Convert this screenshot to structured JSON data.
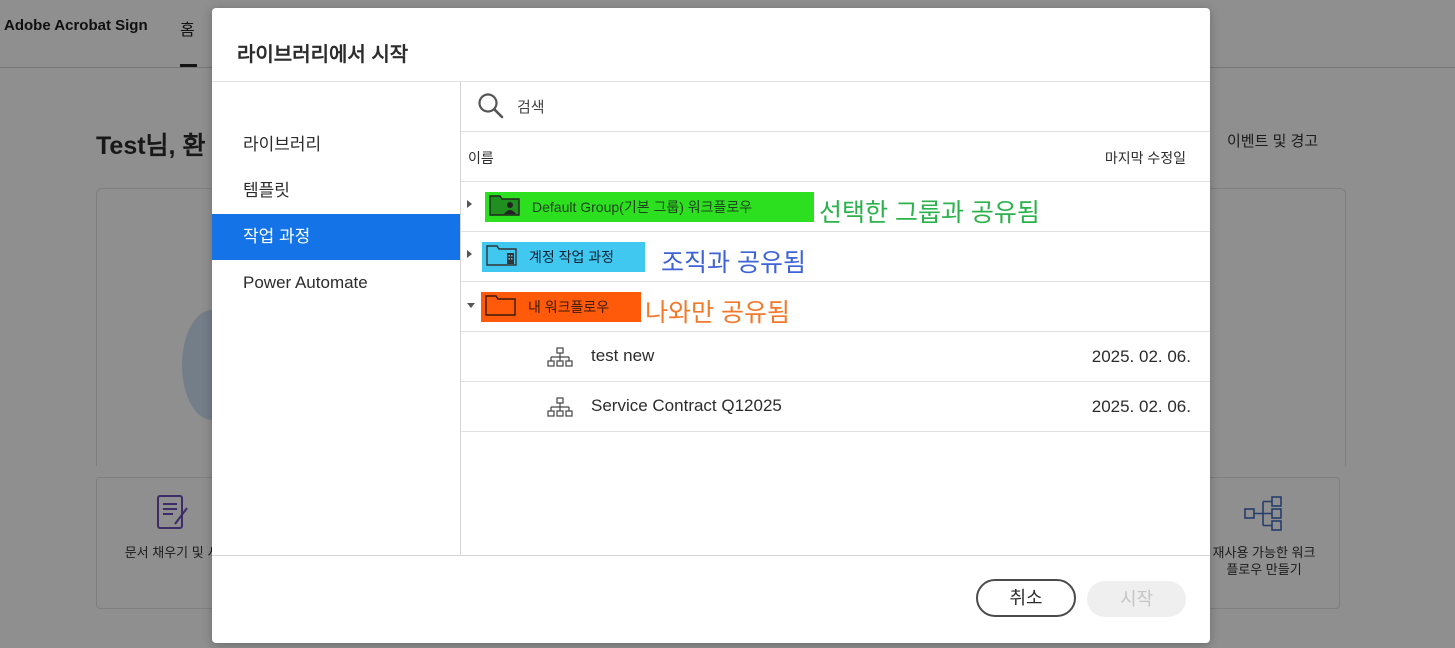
{
  "app": {
    "brand": "Adobe Acrobat Sign",
    "nav_home": "홈",
    "welcome": "Test님, 환",
    "events_link": "이벤트 및 경고",
    "card_left_label": "문서 채우기 및 서",
    "card_right_label_line1": "재사용 가능한 워크",
    "card_right_label_line2": "플로우 만들기"
  },
  "modal": {
    "title": "라이브러리에서 시작",
    "sidebar": {
      "items": [
        {
          "label": "라이브러리",
          "active": false
        },
        {
          "label": "템플릿",
          "active": false
        },
        {
          "label": "작업 과정",
          "active": true
        },
        {
          "label": "Power Automate",
          "active": false
        }
      ]
    },
    "search": {
      "placeholder": "검색",
      "value": ""
    },
    "columns": {
      "name": "이름",
      "last_modified": "마지막 수정일"
    },
    "groups": [
      {
        "label": "Default Group(기본 그룹) 워크플로우",
        "expanded": false,
        "highlight_color": "#2ce01f",
        "annotation": "선택한 그룹과 공유됨",
        "annotation_color": "#2bb24c",
        "icon": "group-folder-icon"
      },
      {
        "label": "계정 작업 과정",
        "expanded": false,
        "highlight_color": "#41c8f0",
        "annotation": "조직과 공유됨",
        "annotation_color": "#3e63d6",
        "icon": "account-folder-icon"
      },
      {
        "label": "내 워크플로우",
        "expanded": true,
        "highlight_color": "#ff5a0a",
        "annotation": "나와만 공유됨",
        "annotation_color": "#f2792a",
        "icon": "folder-icon"
      }
    ],
    "workflows": [
      {
        "name": "test new",
        "date": "2025. 02. 06.",
        "icon": "workflow-icon"
      },
      {
        "name": "Service Contract Q12025",
        "date": "2025. 02. 06.",
        "icon": "workflow-icon"
      }
    ],
    "buttons": {
      "cancel": "취소",
      "start": "시작"
    },
    "accent_color": "#1473e6"
  }
}
